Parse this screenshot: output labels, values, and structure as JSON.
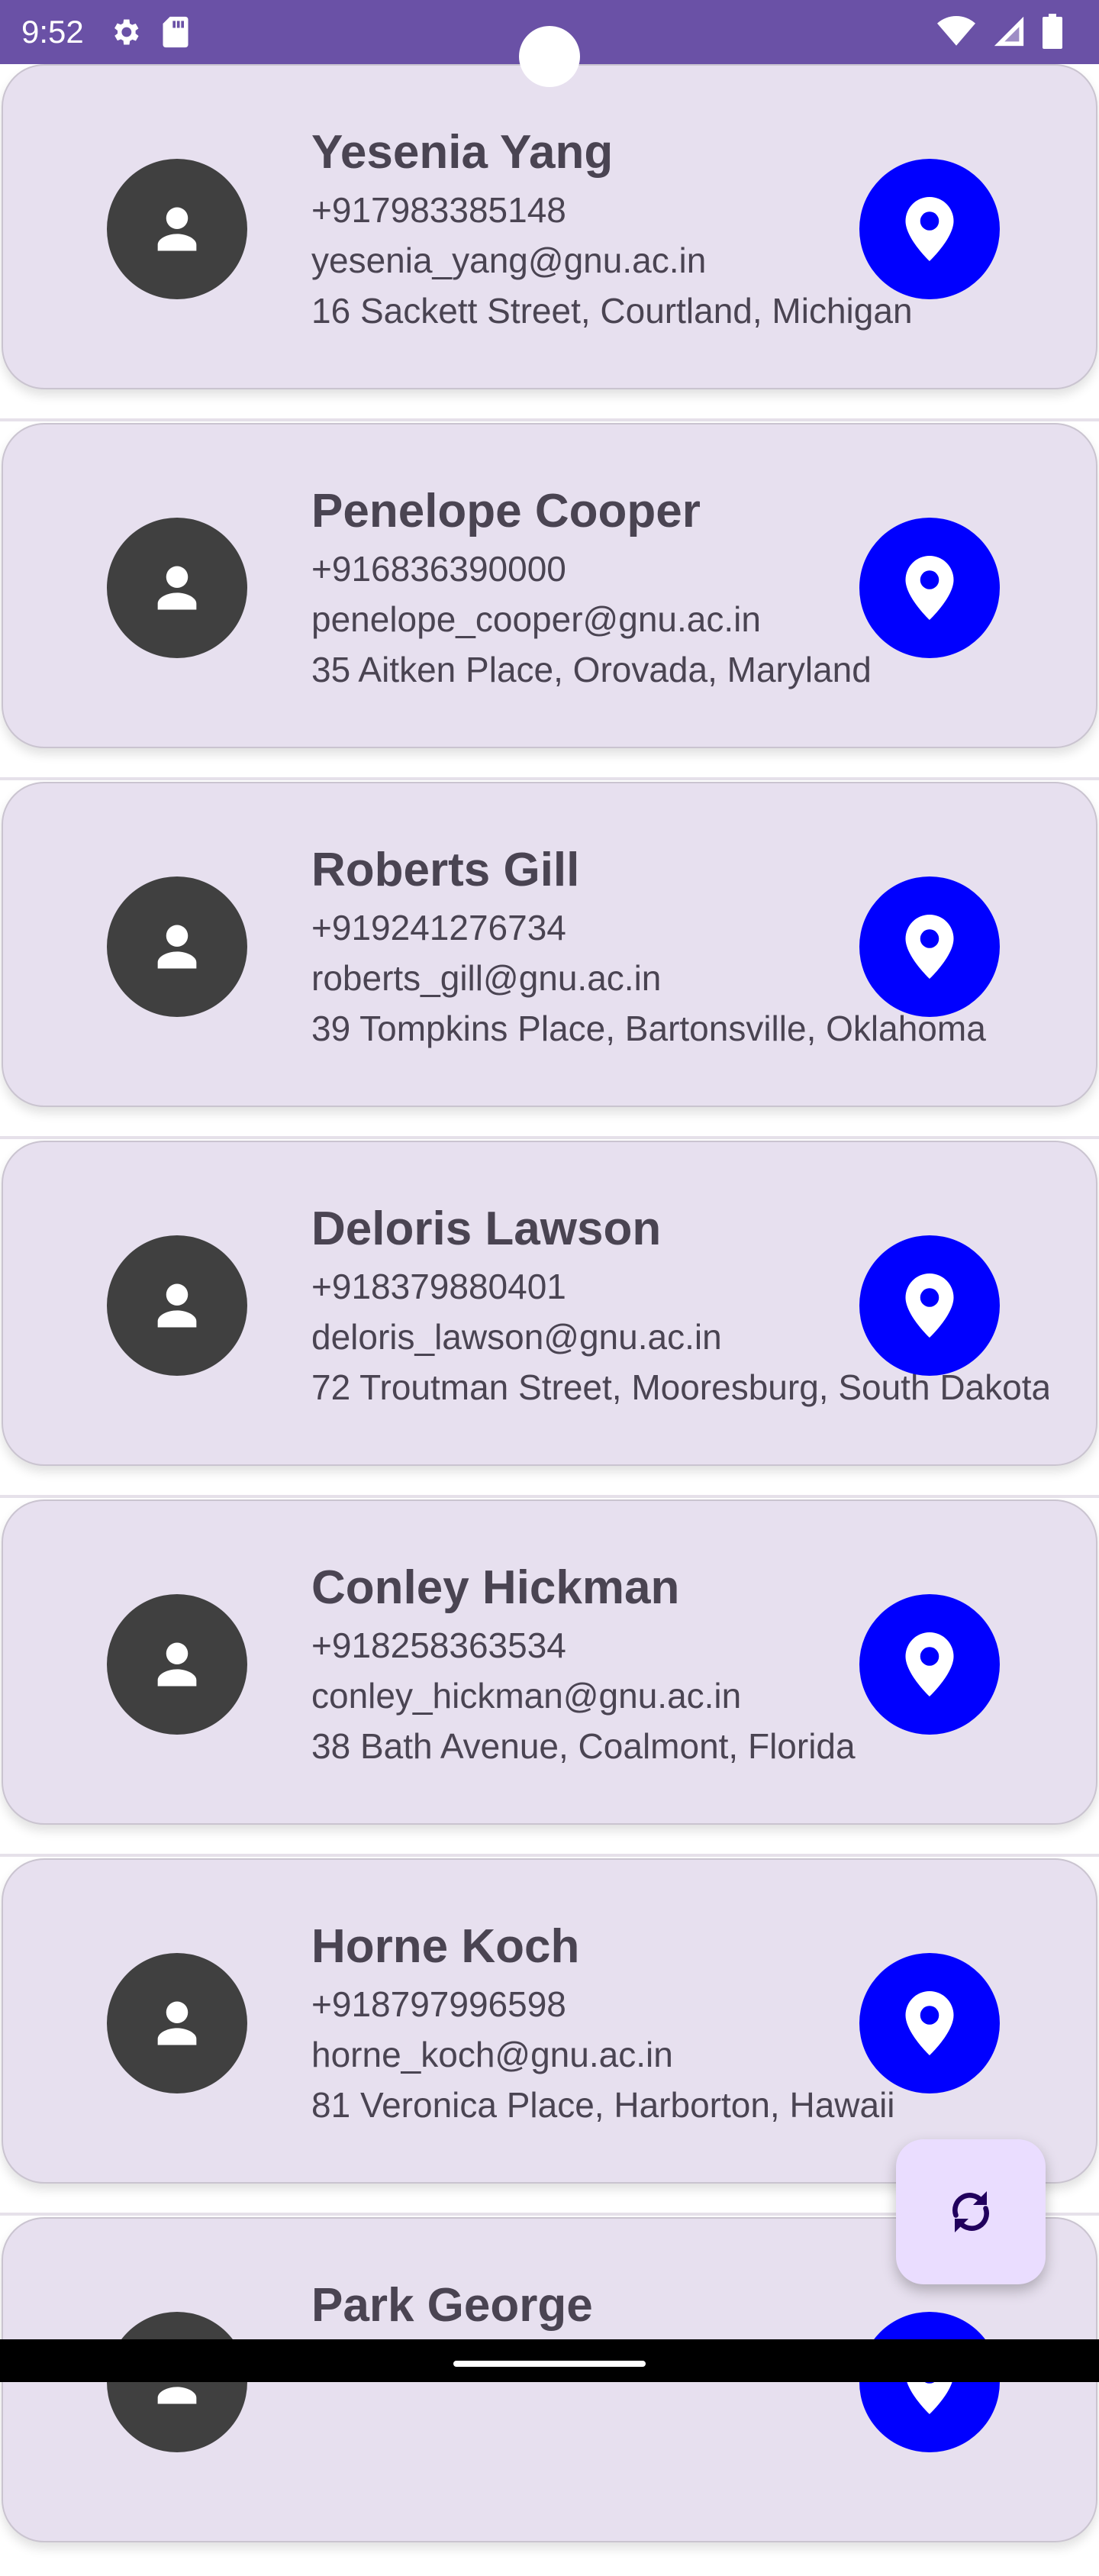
{
  "status_bar": {
    "time": "9:52",
    "left_icons": [
      "gear-icon",
      "sd-card-icon"
    ],
    "right_icons": [
      "wifi-icon",
      "signal-icon",
      "battery-icon"
    ],
    "background": "#6a51a6"
  },
  "contacts": [
    {
      "name": "Yesenia Yang",
      "phone": "+917983385148",
      "email": "yesenia_yang@gnu.ac.in",
      "address": "16 Sackett Street, Courtland, Michigan"
    },
    {
      "name": "Penelope Cooper",
      "phone": "+916836390000",
      "email": "penelope_cooper@gnu.ac.in",
      "address": "35 Aitken Place, Orovada, Maryland"
    },
    {
      "name": "Roberts Gill",
      "phone": "+919241276734",
      "email": "roberts_gill@gnu.ac.in",
      "address": "39 Tompkins Place, Bartonsville, Oklahoma"
    },
    {
      "name": "Deloris Lawson",
      "phone": "+918379880401",
      "email": "deloris_lawson@gnu.ac.in",
      "address": "72 Troutman Street, Mooresburg, South Dakota"
    },
    {
      "name": "Conley Hickman",
      "phone": "+918258363534",
      "email": "conley_hickman@gnu.ac.in",
      "address": "38 Bath Avenue, Coalmont, Florida"
    },
    {
      "name": "Horne Koch",
      "phone": "+918797996598",
      "email": "horne_koch@gnu.ac.in",
      "address": "81 Veronica Place, Harborton, Hawaii"
    },
    {
      "name": "Park George",
      "phone": "",
      "email": "",
      "address": ""
    }
  ],
  "icons": {
    "avatar": "person-icon",
    "location": "location-pin-icon",
    "fab": "refresh-icon"
  },
  "colors": {
    "card_background": "#e7e0ef",
    "avatar_background": "#404040",
    "location_button": "#0000ff",
    "fab_background": "#eaddff",
    "text": "#4a4452"
  }
}
